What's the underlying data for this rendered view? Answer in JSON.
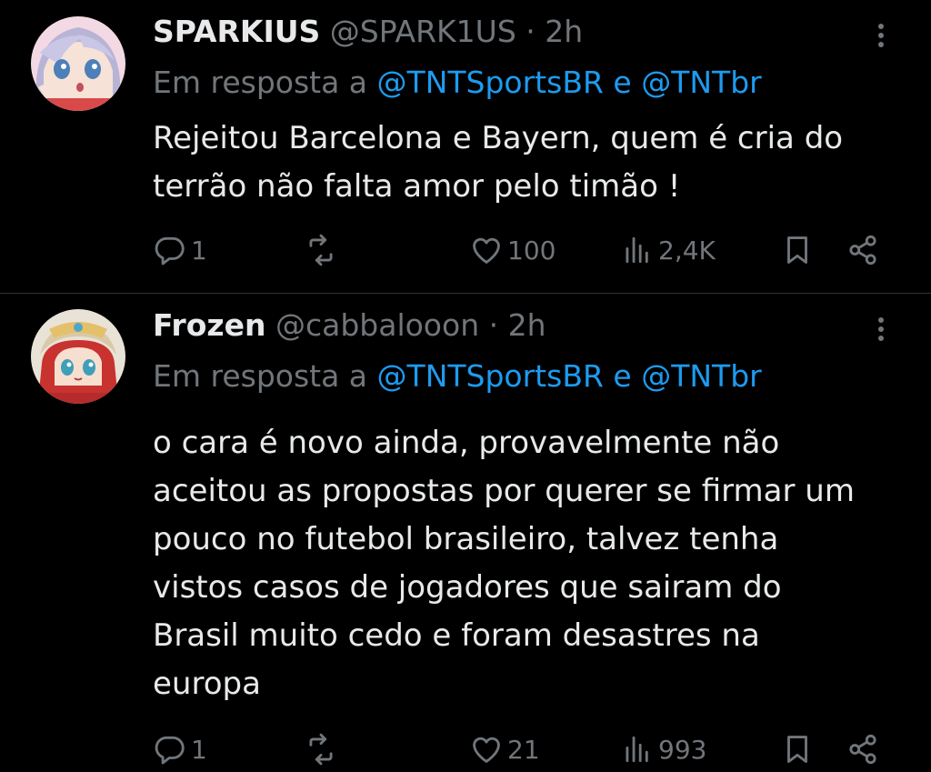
{
  "tweets": [
    {
      "name": "SPARKIUS",
      "handle": "@SPARK1US",
      "separator": "·",
      "time": "2h",
      "reply_prefix": "Em resposta a",
      "mention_1": "@TNTSportsBR",
      "reply_joiner": "e",
      "mention_2": "@TNTbr",
      "body_lines": [
        "Rejeitou Barcelona e Bayern, quem é cria do",
        "terrão não falta amor pelo timão !"
      ],
      "replies": "1",
      "retweets": "",
      "likes": "100",
      "views": "2,4K"
    },
    {
      "name": "Frozen",
      "handle": "@cabbalooon",
      "separator": "·",
      "time": "2h",
      "reply_prefix": "Em resposta a",
      "mention_1": "@TNTSportsBR",
      "reply_joiner": "e",
      "mention_2": "@TNTbr",
      "body_lines": [
        "o cara é novo ainda, provavelmente não",
        "aceitou as propostas por querer se firmar um",
        "pouco no futebol brasileiro, talvez tenha",
        "vistos casos de jogadores que sairam do",
        "Brasil muito cedo e foram desastres na",
        "europa"
      ],
      "replies": "1",
      "retweets": "",
      "likes": "21",
      "views": "993"
    }
  ],
  "colors": {
    "background": "#000000",
    "text": "#e7e9ea",
    "muted": "#71767b",
    "link": "#1d9bf0",
    "divider": "#2f3336"
  },
  "icons": {
    "reply": "reply-icon",
    "retweet": "retweet-icon",
    "like": "heart-icon",
    "views": "views-icon",
    "bookmark": "bookmark-icon",
    "share": "share-icon",
    "more": "more-icon"
  }
}
